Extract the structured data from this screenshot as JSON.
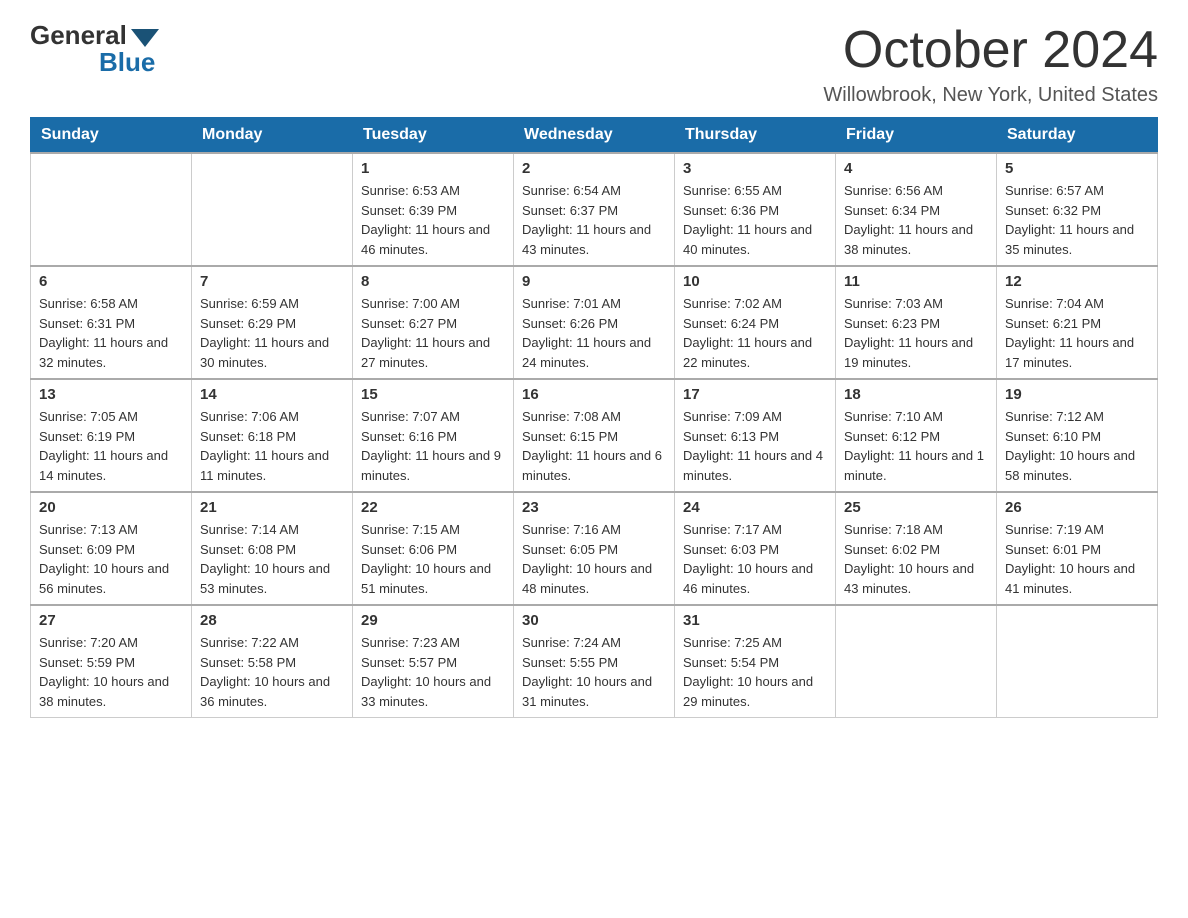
{
  "header": {
    "logo_general": "General",
    "logo_blue": "Blue",
    "title": "October 2024",
    "location": "Willowbrook, New York, United States"
  },
  "days_of_week": [
    "Sunday",
    "Monday",
    "Tuesday",
    "Wednesday",
    "Thursday",
    "Friday",
    "Saturday"
  ],
  "weeks": [
    [
      {
        "day": "",
        "sunrise": "",
        "sunset": "",
        "daylight": ""
      },
      {
        "day": "",
        "sunrise": "",
        "sunset": "",
        "daylight": ""
      },
      {
        "day": "1",
        "sunrise": "Sunrise: 6:53 AM",
        "sunset": "Sunset: 6:39 PM",
        "daylight": "Daylight: 11 hours and 46 minutes."
      },
      {
        "day": "2",
        "sunrise": "Sunrise: 6:54 AM",
        "sunset": "Sunset: 6:37 PM",
        "daylight": "Daylight: 11 hours and 43 minutes."
      },
      {
        "day": "3",
        "sunrise": "Sunrise: 6:55 AM",
        "sunset": "Sunset: 6:36 PM",
        "daylight": "Daylight: 11 hours and 40 minutes."
      },
      {
        "day": "4",
        "sunrise": "Sunrise: 6:56 AM",
        "sunset": "Sunset: 6:34 PM",
        "daylight": "Daylight: 11 hours and 38 minutes."
      },
      {
        "day": "5",
        "sunrise": "Sunrise: 6:57 AM",
        "sunset": "Sunset: 6:32 PM",
        "daylight": "Daylight: 11 hours and 35 minutes."
      }
    ],
    [
      {
        "day": "6",
        "sunrise": "Sunrise: 6:58 AM",
        "sunset": "Sunset: 6:31 PM",
        "daylight": "Daylight: 11 hours and 32 minutes."
      },
      {
        "day": "7",
        "sunrise": "Sunrise: 6:59 AM",
        "sunset": "Sunset: 6:29 PM",
        "daylight": "Daylight: 11 hours and 30 minutes."
      },
      {
        "day": "8",
        "sunrise": "Sunrise: 7:00 AM",
        "sunset": "Sunset: 6:27 PM",
        "daylight": "Daylight: 11 hours and 27 minutes."
      },
      {
        "day": "9",
        "sunrise": "Sunrise: 7:01 AM",
        "sunset": "Sunset: 6:26 PM",
        "daylight": "Daylight: 11 hours and 24 minutes."
      },
      {
        "day": "10",
        "sunrise": "Sunrise: 7:02 AM",
        "sunset": "Sunset: 6:24 PM",
        "daylight": "Daylight: 11 hours and 22 minutes."
      },
      {
        "day": "11",
        "sunrise": "Sunrise: 7:03 AM",
        "sunset": "Sunset: 6:23 PM",
        "daylight": "Daylight: 11 hours and 19 minutes."
      },
      {
        "day": "12",
        "sunrise": "Sunrise: 7:04 AM",
        "sunset": "Sunset: 6:21 PM",
        "daylight": "Daylight: 11 hours and 17 minutes."
      }
    ],
    [
      {
        "day": "13",
        "sunrise": "Sunrise: 7:05 AM",
        "sunset": "Sunset: 6:19 PM",
        "daylight": "Daylight: 11 hours and 14 minutes."
      },
      {
        "day": "14",
        "sunrise": "Sunrise: 7:06 AM",
        "sunset": "Sunset: 6:18 PM",
        "daylight": "Daylight: 11 hours and 11 minutes."
      },
      {
        "day": "15",
        "sunrise": "Sunrise: 7:07 AM",
        "sunset": "Sunset: 6:16 PM",
        "daylight": "Daylight: 11 hours and 9 minutes."
      },
      {
        "day": "16",
        "sunrise": "Sunrise: 7:08 AM",
        "sunset": "Sunset: 6:15 PM",
        "daylight": "Daylight: 11 hours and 6 minutes."
      },
      {
        "day": "17",
        "sunrise": "Sunrise: 7:09 AM",
        "sunset": "Sunset: 6:13 PM",
        "daylight": "Daylight: 11 hours and 4 minutes."
      },
      {
        "day": "18",
        "sunrise": "Sunrise: 7:10 AM",
        "sunset": "Sunset: 6:12 PM",
        "daylight": "Daylight: 11 hours and 1 minute."
      },
      {
        "day": "19",
        "sunrise": "Sunrise: 7:12 AM",
        "sunset": "Sunset: 6:10 PM",
        "daylight": "Daylight: 10 hours and 58 minutes."
      }
    ],
    [
      {
        "day": "20",
        "sunrise": "Sunrise: 7:13 AM",
        "sunset": "Sunset: 6:09 PM",
        "daylight": "Daylight: 10 hours and 56 minutes."
      },
      {
        "day": "21",
        "sunrise": "Sunrise: 7:14 AM",
        "sunset": "Sunset: 6:08 PM",
        "daylight": "Daylight: 10 hours and 53 minutes."
      },
      {
        "day": "22",
        "sunrise": "Sunrise: 7:15 AM",
        "sunset": "Sunset: 6:06 PM",
        "daylight": "Daylight: 10 hours and 51 minutes."
      },
      {
        "day": "23",
        "sunrise": "Sunrise: 7:16 AM",
        "sunset": "Sunset: 6:05 PM",
        "daylight": "Daylight: 10 hours and 48 minutes."
      },
      {
        "day": "24",
        "sunrise": "Sunrise: 7:17 AM",
        "sunset": "Sunset: 6:03 PM",
        "daylight": "Daylight: 10 hours and 46 minutes."
      },
      {
        "day": "25",
        "sunrise": "Sunrise: 7:18 AM",
        "sunset": "Sunset: 6:02 PM",
        "daylight": "Daylight: 10 hours and 43 minutes."
      },
      {
        "day": "26",
        "sunrise": "Sunrise: 7:19 AM",
        "sunset": "Sunset: 6:01 PM",
        "daylight": "Daylight: 10 hours and 41 minutes."
      }
    ],
    [
      {
        "day": "27",
        "sunrise": "Sunrise: 7:20 AM",
        "sunset": "Sunset: 5:59 PM",
        "daylight": "Daylight: 10 hours and 38 minutes."
      },
      {
        "day": "28",
        "sunrise": "Sunrise: 7:22 AM",
        "sunset": "Sunset: 5:58 PM",
        "daylight": "Daylight: 10 hours and 36 minutes."
      },
      {
        "day": "29",
        "sunrise": "Sunrise: 7:23 AM",
        "sunset": "Sunset: 5:57 PM",
        "daylight": "Daylight: 10 hours and 33 minutes."
      },
      {
        "day": "30",
        "sunrise": "Sunrise: 7:24 AM",
        "sunset": "Sunset: 5:55 PM",
        "daylight": "Daylight: 10 hours and 31 minutes."
      },
      {
        "day": "31",
        "sunrise": "Sunrise: 7:25 AM",
        "sunset": "Sunset: 5:54 PM",
        "daylight": "Daylight: 10 hours and 29 minutes."
      },
      {
        "day": "",
        "sunrise": "",
        "sunset": "",
        "daylight": ""
      },
      {
        "day": "",
        "sunrise": "",
        "sunset": "",
        "daylight": ""
      }
    ]
  ]
}
